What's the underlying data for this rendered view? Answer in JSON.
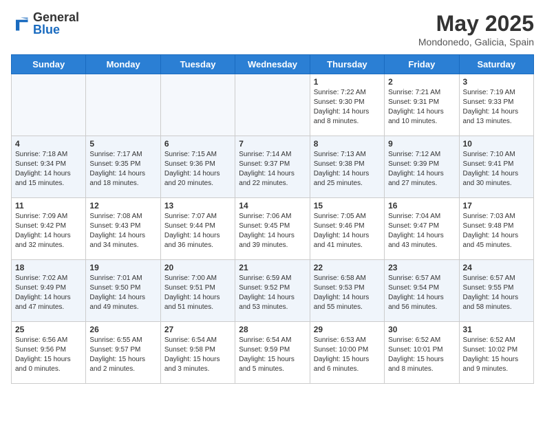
{
  "header": {
    "logo_general": "General",
    "logo_blue": "Blue",
    "main_title": "May 2025",
    "subtitle": "Mondonedo, Galicia, Spain"
  },
  "days_of_week": [
    "Sunday",
    "Monday",
    "Tuesday",
    "Wednesday",
    "Thursday",
    "Friday",
    "Saturday"
  ],
  "weeks": [
    [
      {
        "day": "",
        "info": ""
      },
      {
        "day": "",
        "info": ""
      },
      {
        "day": "",
        "info": ""
      },
      {
        "day": "",
        "info": ""
      },
      {
        "day": "1",
        "info": "Sunrise: 7:22 AM\nSunset: 9:30 PM\nDaylight: 14 hours\nand 8 minutes."
      },
      {
        "day": "2",
        "info": "Sunrise: 7:21 AM\nSunset: 9:31 PM\nDaylight: 14 hours\nand 10 minutes."
      },
      {
        "day": "3",
        "info": "Sunrise: 7:19 AM\nSunset: 9:33 PM\nDaylight: 14 hours\nand 13 minutes."
      }
    ],
    [
      {
        "day": "4",
        "info": "Sunrise: 7:18 AM\nSunset: 9:34 PM\nDaylight: 14 hours\nand 15 minutes."
      },
      {
        "day": "5",
        "info": "Sunrise: 7:17 AM\nSunset: 9:35 PM\nDaylight: 14 hours\nand 18 minutes."
      },
      {
        "day": "6",
        "info": "Sunrise: 7:15 AM\nSunset: 9:36 PM\nDaylight: 14 hours\nand 20 minutes."
      },
      {
        "day": "7",
        "info": "Sunrise: 7:14 AM\nSunset: 9:37 PM\nDaylight: 14 hours\nand 22 minutes."
      },
      {
        "day": "8",
        "info": "Sunrise: 7:13 AM\nSunset: 9:38 PM\nDaylight: 14 hours\nand 25 minutes."
      },
      {
        "day": "9",
        "info": "Sunrise: 7:12 AM\nSunset: 9:39 PM\nDaylight: 14 hours\nand 27 minutes."
      },
      {
        "day": "10",
        "info": "Sunrise: 7:10 AM\nSunset: 9:41 PM\nDaylight: 14 hours\nand 30 minutes."
      }
    ],
    [
      {
        "day": "11",
        "info": "Sunrise: 7:09 AM\nSunset: 9:42 PM\nDaylight: 14 hours\nand 32 minutes."
      },
      {
        "day": "12",
        "info": "Sunrise: 7:08 AM\nSunset: 9:43 PM\nDaylight: 14 hours\nand 34 minutes."
      },
      {
        "day": "13",
        "info": "Sunrise: 7:07 AM\nSunset: 9:44 PM\nDaylight: 14 hours\nand 36 minutes."
      },
      {
        "day": "14",
        "info": "Sunrise: 7:06 AM\nSunset: 9:45 PM\nDaylight: 14 hours\nand 39 minutes."
      },
      {
        "day": "15",
        "info": "Sunrise: 7:05 AM\nSunset: 9:46 PM\nDaylight: 14 hours\nand 41 minutes."
      },
      {
        "day": "16",
        "info": "Sunrise: 7:04 AM\nSunset: 9:47 PM\nDaylight: 14 hours\nand 43 minutes."
      },
      {
        "day": "17",
        "info": "Sunrise: 7:03 AM\nSunset: 9:48 PM\nDaylight: 14 hours\nand 45 minutes."
      }
    ],
    [
      {
        "day": "18",
        "info": "Sunrise: 7:02 AM\nSunset: 9:49 PM\nDaylight: 14 hours\nand 47 minutes."
      },
      {
        "day": "19",
        "info": "Sunrise: 7:01 AM\nSunset: 9:50 PM\nDaylight: 14 hours\nand 49 minutes."
      },
      {
        "day": "20",
        "info": "Sunrise: 7:00 AM\nSunset: 9:51 PM\nDaylight: 14 hours\nand 51 minutes."
      },
      {
        "day": "21",
        "info": "Sunrise: 6:59 AM\nSunset: 9:52 PM\nDaylight: 14 hours\nand 53 minutes."
      },
      {
        "day": "22",
        "info": "Sunrise: 6:58 AM\nSunset: 9:53 PM\nDaylight: 14 hours\nand 55 minutes."
      },
      {
        "day": "23",
        "info": "Sunrise: 6:57 AM\nSunset: 9:54 PM\nDaylight: 14 hours\nand 56 minutes."
      },
      {
        "day": "24",
        "info": "Sunrise: 6:57 AM\nSunset: 9:55 PM\nDaylight: 14 hours\nand 58 minutes."
      }
    ],
    [
      {
        "day": "25",
        "info": "Sunrise: 6:56 AM\nSunset: 9:56 PM\nDaylight: 15 hours\nand 0 minutes."
      },
      {
        "day": "26",
        "info": "Sunrise: 6:55 AM\nSunset: 9:57 PM\nDaylight: 15 hours\nand 2 minutes."
      },
      {
        "day": "27",
        "info": "Sunrise: 6:54 AM\nSunset: 9:58 PM\nDaylight: 15 hours\nand 3 minutes."
      },
      {
        "day": "28",
        "info": "Sunrise: 6:54 AM\nSunset: 9:59 PM\nDaylight: 15 hours\nand 5 minutes."
      },
      {
        "day": "29",
        "info": "Sunrise: 6:53 AM\nSunset: 10:00 PM\nDaylight: 15 hours\nand 6 minutes."
      },
      {
        "day": "30",
        "info": "Sunrise: 6:52 AM\nSunset: 10:01 PM\nDaylight: 15 hours\nand 8 minutes."
      },
      {
        "day": "31",
        "info": "Sunrise: 6:52 AM\nSunset: 10:02 PM\nDaylight: 15 hours\nand 9 minutes."
      }
    ]
  ]
}
